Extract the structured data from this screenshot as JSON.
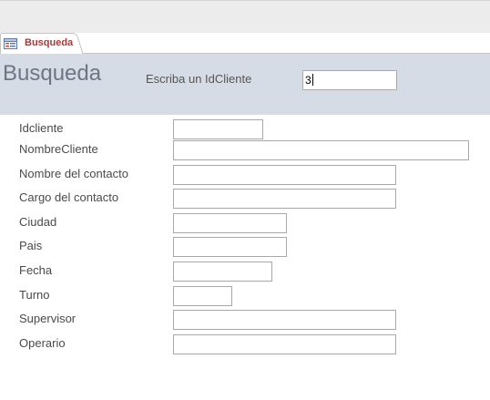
{
  "tab": {
    "label": "Busqueda",
    "icon": "form-icon"
  },
  "header": {
    "title": "Busqueda",
    "search_label": "Escriba un IdCliente",
    "search_value": "3"
  },
  "fields": [
    {
      "label": "Idcliente",
      "value": ""
    },
    {
      "label": "NombreCliente",
      "value": ""
    },
    {
      "label": "Nombre del contacto",
      "value": ""
    },
    {
      "label": "Cargo del contacto",
      "value": ""
    },
    {
      "label": "Ciudad",
      "value": ""
    },
    {
      "label": "Pais",
      "value": ""
    },
    {
      "label": "Fecha",
      "value": ""
    },
    {
      "label": "Turno",
      "value": ""
    },
    {
      "label": "Supervisor",
      "value": ""
    },
    {
      "label": "Operario",
      "value": ""
    }
  ],
  "colors": {
    "header_band": "#d6dce5",
    "tab_label": "#a33a3a",
    "title": "#6e7583"
  }
}
